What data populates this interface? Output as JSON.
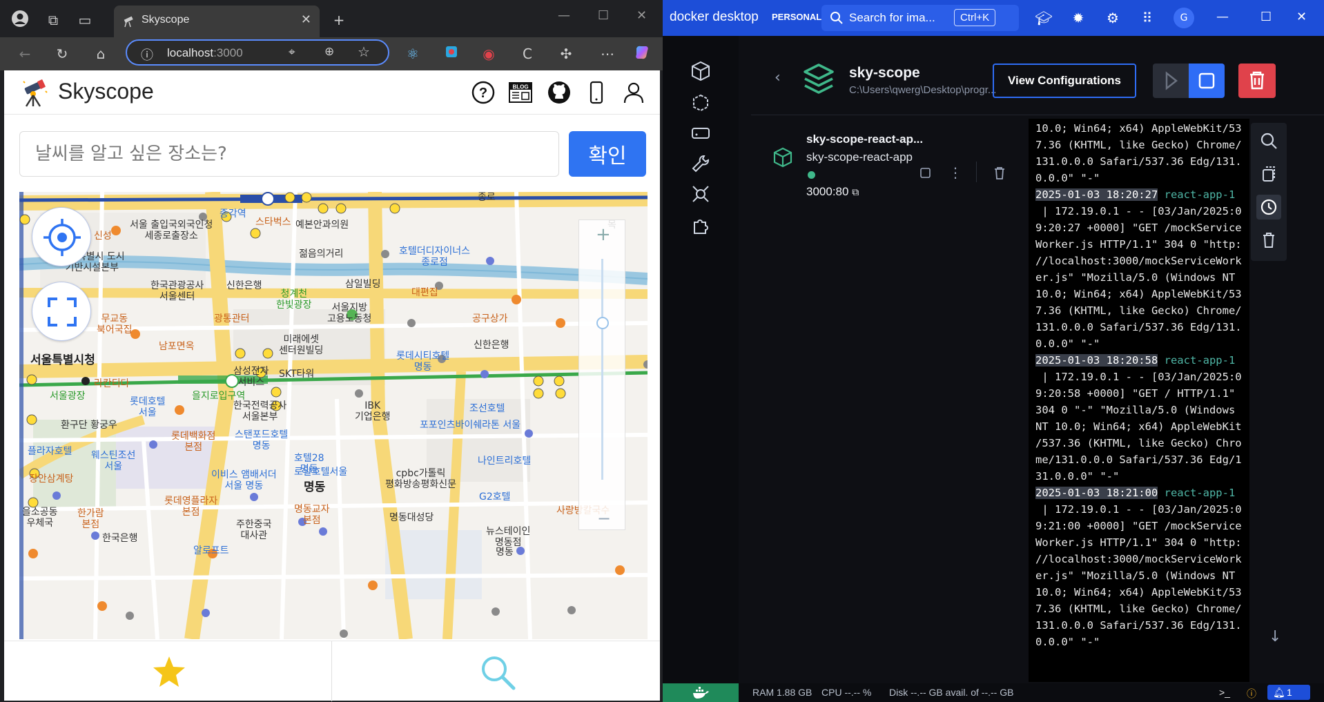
{
  "browser": {
    "tab_title": "Skyscope",
    "address_host": "localhost",
    "address_port": ":3000"
  },
  "app": {
    "title": "Skyscope",
    "search_placeholder": "날씨를 알고 싶은 장소는?",
    "confirm_label": "확인",
    "blog_label": "BLOG"
  },
  "map": {
    "labels": [
      {
        "t": "신성",
        "c": "or"
      },
      {
        "t": "서울 출입국외국인청\n세종로출장소",
        "c": ""
      },
      {
        "t": "스타벅스",
        "c": "or"
      },
      {
        "t": "예본안과의원",
        "c": ""
      },
      {
        "t": "종각역",
        "c": "bl"
      },
      {
        "t": "서울특별시 도시\n기반시설본부",
        "c": ""
      },
      {
        "t": "젊음의거리",
        "c": ""
      },
      {
        "t": "호텔더디자이너스\n종로점",
        "c": "bl"
      },
      {
        "t": "한국관광공사\n서울센터",
        "c": ""
      },
      {
        "t": "신한은행",
        "c": ""
      },
      {
        "t": "청계천\n한빛광장",
        "c": "gr"
      },
      {
        "t": "삼일빌딩",
        "c": ""
      },
      {
        "t": "대편집",
        "c": "or"
      },
      {
        "t": "무교동\n북어국집",
        "c": "or"
      },
      {
        "t": "광통관터",
        "c": "or"
      },
      {
        "t": "서울지방\n고용노동청",
        "c": ""
      },
      {
        "t": "공구상가",
        "c": "or"
      },
      {
        "t": "남포면옥",
        "c": "or"
      },
      {
        "t": "미래에셋\n센터원빌딩",
        "c": ""
      },
      {
        "t": "서울특별시청",
        "c": "big"
      },
      {
        "t": "롯데시티호텔\n명동",
        "c": "bl"
      },
      {
        "t": "신한은행",
        "c": ""
      },
      {
        "t": "라칸티다",
        "c": "or"
      },
      {
        "t": "삼성전자\n서비스",
        "c": ""
      },
      {
        "t": "SKT타워",
        "c": ""
      },
      {
        "t": "서울광장",
        "c": "gr"
      },
      {
        "t": "롯데호텔\n서울",
        "c": "bl"
      },
      {
        "t": "을지로입구역",
        "c": "gr"
      },
      {
        "t": "한국전력공사\n서울본부",
        "c": ""
      },
      {
        "t": "IBK\n기업은행",
        "c": ""
      },
      {
        "t": "조선호텔",
        "c": "bl"
      },
      {
        "t": "포포인츠바이쉐라톤 서울",
        "c": "bl"
      },
      {
        "t": "환구단 황궁우",
        "c": ""
      },
      {
        "t": "롯데백화점\n본점",
        "c": "or"
      },
      {
        "t": "스탠포드호텔\n명동",
        "c": "bl"
      },
      {
        "t": "플라자호텔",
        "c": "bl"
      },
      {
        "t": "웨스틴조선\n서울",
        "c": "bl"
      },
      {
        "t": "호텔28\n명동",
        "c": "bl"
      },
      {
        "t": "나인트리호텔",
        "c": "bl"
      },
      {
        "t": "장안삼계탕",
        "c": "or"
      },
      {
        "t": "이비스 앰배서더\n서울 명동",
        "c": "bl"
      },
      {
        "t": "로얄호텔서울",
        "c": "bl"
      },
      {
        "t": "cpbc가톨릭\n평화방송평화신문",
        "c": ""
      },
      {
        "t": "명동",
        "c": "big"
      },
      {
        "t": "G2호텔",
        "c": "bl"
      },
      {
        "t": "롯데영플라자\n본점",
        "c": "or"
      },
      {
        "t": "명동교자\n본점",
        "c": "or"
      },
      {
        "t": "을소공동\n우체국",
        "c": ""
      },
      {
        "t": "한가람\n본점",
        "c": "or"
      },
      {
        "t": "사랑방칼국수",
        "c": "or"
      },
      {
        "t": "주한중국\n대사관",
        "c": ""
      },
      {
        "t": "명동대성당",
        "c": ""
      },
      {
        "t": "뉴스테이인\n명동점",
        "c": ""
      },
      {
        "t": "한국은행",
        "c": ""
      },
      {
        "t": "알로프트",
        "c": "bl"
      },
      {
        "t": "종로",
        "c": ""
      },
      {
        "t": "목",
        "c": ""
      },
      {
        "t": "명동",
        "c": ""
      }
    ]
  },
  "docker": {
    "brand": "docker desktop",
    "plan": "PERSONAL",
    "search_text": "Search for ima...",
    "search_kbd": "Ctrl+K",
    "avatar": "G",
    "project_name": "sky-scope",
    "project_path": "C:\\Users\\qwerg\\Desktop\\progr...",
    "view_config_label": "View Configurations",
    "container_name": "sky-scope-react-ap...",
    "container_image": "sky-scope-react-app",
    "container_port": "3000:80",
    "log_lines": [
      {
        "p": [
          "10.0; Win64; x64) AppleWebKit/53"
        ]
      },
      {
        "p": [
          "7.36 (KHTML, like Gecko) Chrome/"
        ]
      },
      {
        "p": [
          "131.0.0.0 Safari/537.36 Edg/131."
        ]
      },
      {
        "p": [
          "0.0.0\" \"-\""
        ]
      },
      {
        "ts": "2025-01-03 18:20:27",
        "src": " react-app-1"
      },
      {
        "p": [
          " | 172.19.0.1 - - [03/Jan/2025:0"
        ]
      },
      {
        "p": [
          "9:20:27 +0000] \"GET /mockService"
        ]
      },
      {
        "p": [
          "Worker.js HTTP/1.1\" 304 0 \"http:"
        ]
      },
      {
        "p": [
          "//localhost:3000/mockServiceWork"
        ]
      },
      {
        "p": [
          "er.js\" \"Mozilla/5.0 (Windows NT"
        ]
      },
      {
        "p": [
          "10.0; Win64; x64) AppleWebKit/53"
        ]
      },
      {
        "p": [
          "7.36 (KHTML, like Gecko) Chrome/"
        ]
      },
      {
        "p": [
          "131.0.0.0 Safari/537.36 Edg/131."
        ]
      },
      {
        "p": [
          "0.0.0\" \"-\""
        ]
      },
      {
        "ts": "2025-01-03 18:20:58",
        "src": " react-app-1"
      },
      {
        "p": [
          " | 172.19.0.1 - - [03/Jan/2025:0"
        ]
      },
      {
        "p": [
          "9:20:58 +0000] \"GET / HTTP/1.1\""
        ]
      },
      {
        "p": [
          "304 0 \"-\" \"Mozilla/5.0 (Windows"
        ]
      },
      {
        "p": [
          "NT 10.0; Win64; x64) AppleWebKit"
        ]
      },
      {
        "p": [
          "/537.36 (KHTML, like Gecko) Chro"
        ]
      },
      {
        "p": [
          "me/131.0.0.0 Safari/537.36 Edg/1"
        ]
      },
      {
        "p": [
          "31.0.0.0\" \"-\""
        ]
      },
      {
        "ts": "2025-01-03 18:21:00",
        "src": " react-app-1"
      },
      {
        "p": [
          " | 172.19.0.1 - - [03/Jan/2025:0"
        ]
      },
      {
        "p": [
          "9:21:00 +0000] \"GET /mockService"
        ]
      },
      {
        "p": [
          "Worker.js HTTP/1.1\" 304 0 \"http:"
        ]
      },
      {
        "p": [
          "//localhost:3000/mockServiceWork"
        ]
      },
      {
        "p": [
          "er.js\" \"Mozilla/5.0 (Windows NT"
        ]
      },
      {
        "p": [
          "10.0; Win64; x64) AppleWebKit/53"
        ]
      },
      {
        "p": [
          "7.36 (KHTML, like Gecko) Chrome/"
        ]
      },
      {
        "p": [
          "131.0.0.0 Safari/537.36 Edg/131."
        ]
      },
      {
        "p": [
          "0.0.0\" \"-\""
        ]
      }
    ],
    "status": {
      "ram": "RAM 1.88 GB",
      "cpu": "CPU --.-- %",
      "disk": "Disk --.-- GB avail. of --.-- GB",
      "notifications": "1"
    },
    "colors": {
      "brand_blue": "#1d4ed8",
      "accent_teal": "#3fb88a",
      "danger": "#e0424b"
    }
  }
}
